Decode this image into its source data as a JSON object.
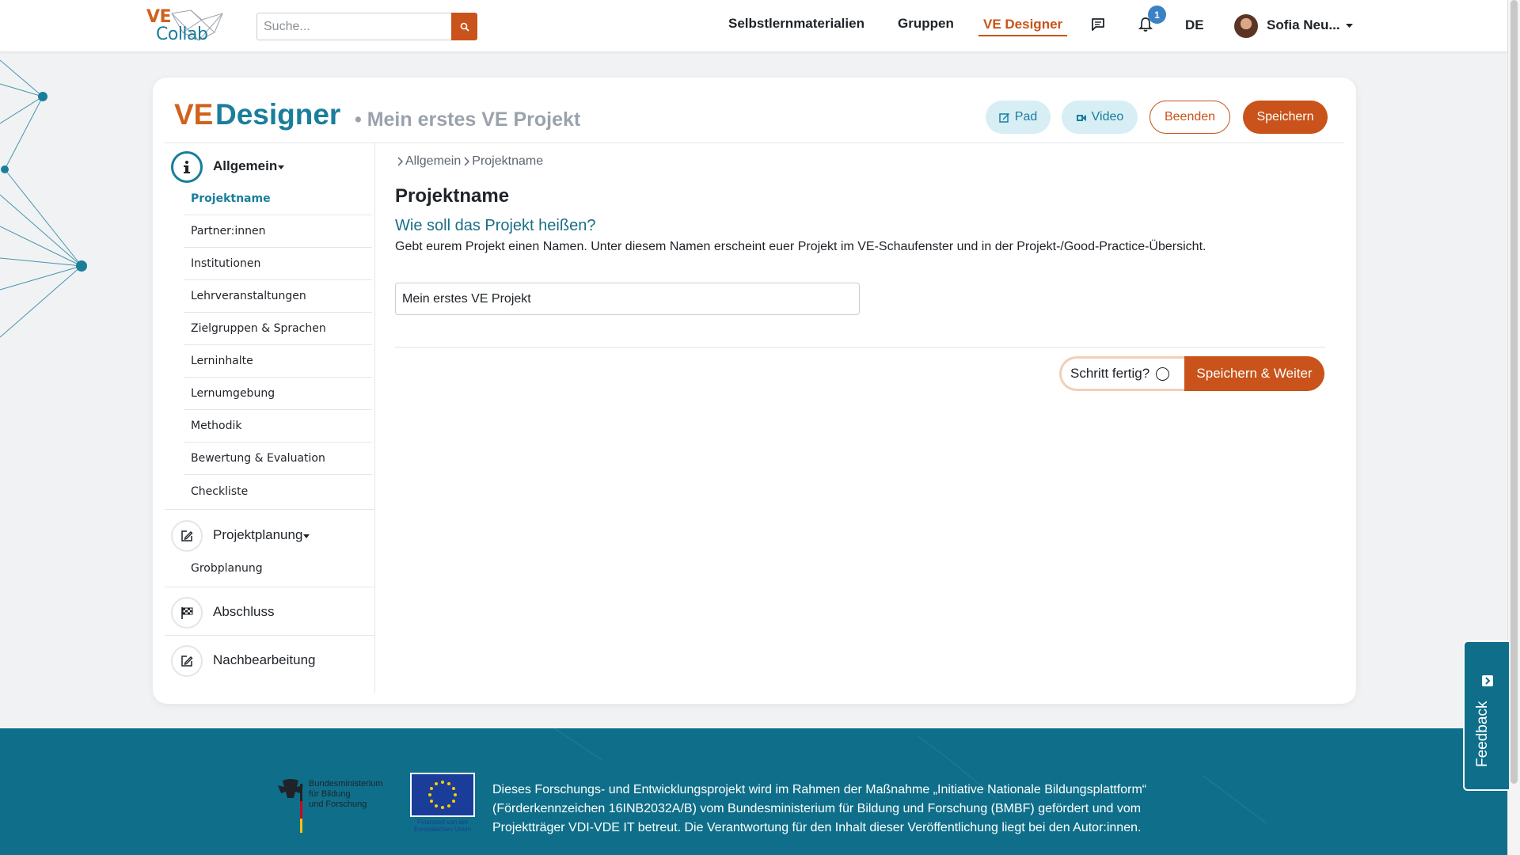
{
  "header": {
    "logo": {
      "ve": "VE",
      "collab": "Collab"
    },
    "search_placeholder": "Suche...",
    "nav": [
      "Selbstlernmaterialien",
      "Gruppen",
      "VE Designer"
    ],
    "notification_count": "1",
    "language": "DE",
    "user_name": "Sofia Neu...",
    "accent_color": "#c9531a",
    "brand_color": "#1a7e9b"
  },
  "card": {
    "title_ve": "VE",
    "title_designer": "Designer",
    "project_name": "• Mein erstes VE Projekt",
    "buttons": {
      "pad": "Pad",
      "video": "Video",
      "end": "Beenden",
      "save": "Speichern"
    }
  },
  "sidebar": {
    "sections": [
      {
        "label": "Allgemein",
        "items": [
          "Projektname",
          "Partner:innen",
          "Institutionen",
          "Lehrveranstaltungen",
          "Zielgruppen & Sprachen",
          "Lerninhalte",
          "Lernumgebung",
          "Methodik",
          "Bewertung & Evaluation",
          "Checkliste"
        ]
      },
      {
        "label": "Projektplanung",
        "items": [
          "Grobplanung"
        ]
      },
      {
        "label": "Abschluss",
        "items": []
      },
      {
        "label": "Nachbearbeitung",
        "items": []
      }
    ]
  },
  "main": {
    "breadcrumb": [
      "Allgemein",
      "Projektname"
    ],
    "title": "Projektname",
    "question": "Wie soll das Projekt heißen?",
    "description": "Gebt eurem Projekt einen Namen. Unter diesem Namen erscheint euer Projekt im VE-Schaufenster und in der Projekt-/Good-Practice-Übersicht.",
    "input_value": "Mein erstes VE Projekt",
    "step_done_label": "Schritt fertig?",
    "save_next_label": "Speichern & Weiter"
  },
  "footer": {
    "bmbf_text": "Bundesministerium\nfür Bildung\nund Forschung",
    "eu_caption": "Finanziert von der Europäischen Union",
    "text": "Dieses Forschungs- und Entwicklungsprojekt wird im Rahmen der Maßnahme „Initiative Nationale Bildungsplattform“ (Förderkennzeichen 16INB2032A/B) vom Bundesministerium für Bildung und Forschung (BMBF) gefördert und vom Projektträger VDI-VDE IT betreut. Die Verantwortung für den Inhalt dieser Veröffentlichung liegt bei den Autor:innen."
  },
  "feedback_label": "Feedback",
  "icons": [
    "search-icon",
    "chat-icon",
    "bell-icon",
    "caret-down-icon",
    "edit-icon",
    "video-icon",
    "info-icon",
    "pencil-square-icon",
    "checkered-flag-icon",
    "chevron-right-icon",
    "external-link-icon"
  ]
}
